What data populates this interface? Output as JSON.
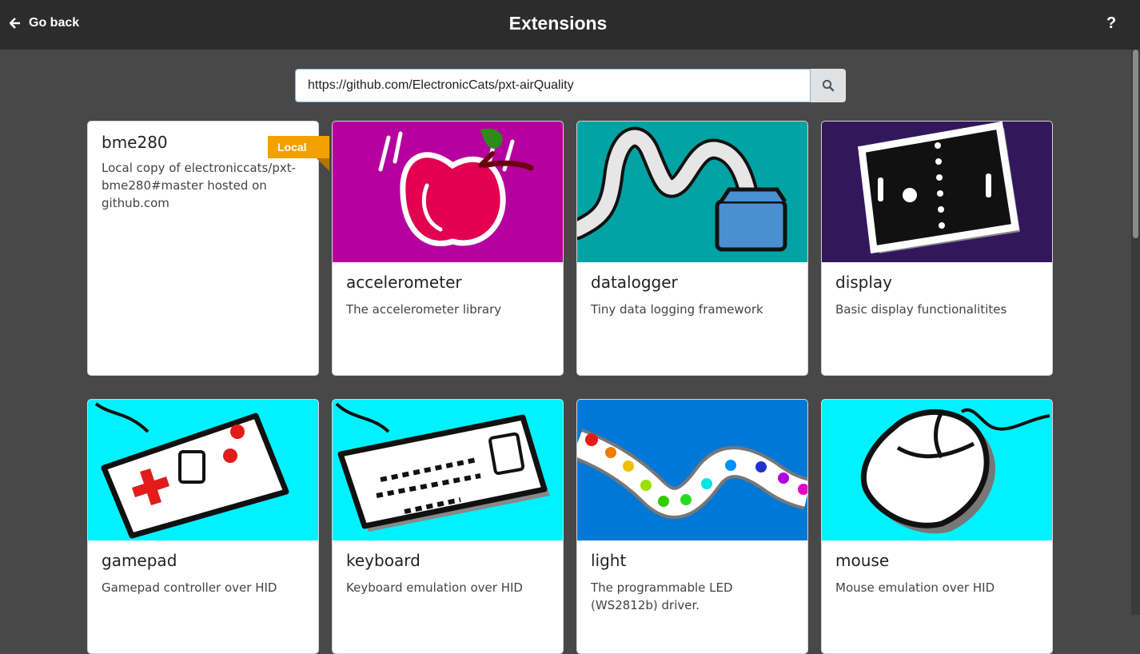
{
  "header": {
    "back_label": "Go back",
    "title": "Extensions",
    "help_label": "?"
  },
  "search": {
    "value": "https://github.com/ElectronicCats/pxt-airQuality",
    "icon": "search-icon"
  },
  "local_badge": "Local",
  "cards": [
    {
      "name": "bme280",
      "desc": "Local copy of electroniccats/pxt-bme280#master hosted on github.com"
    },
    {
      "name": "accelerometer",
      "desc": "The accelerometer library"
    },
    {
      "name": "datalogger",
      "desc": "Tiny data logging framework"
    },
    {
      "name": "display",
      "desc": "Basic display functionalitites"
    },
    {
      "name": "gamepad",
      "desc": "Gamepad controller over HID"
    },
    {
      "name": "keyboard",
      "desc": "Keyboard emulation over HID"
    },
    {
      "name": "light",
      "desc": "The programmable LED (WS2812b) driver."
    },
    {
      "name": "mouse",
      "desc": "Mouse emulation over HID"
    }
  ],
  "colors": {
    "topbar": "#2c2c2c",
    "background": "#484849",
    "badge": "#f2a100",
    "accelerometer_bg": "#b5009f",
    "datalogger_bg": "#00a3a3",
    "display_bg": "#32175c",
    "hid_bg": "#00f2ff",
    "light_bg": "#0078d7"
  }
}
